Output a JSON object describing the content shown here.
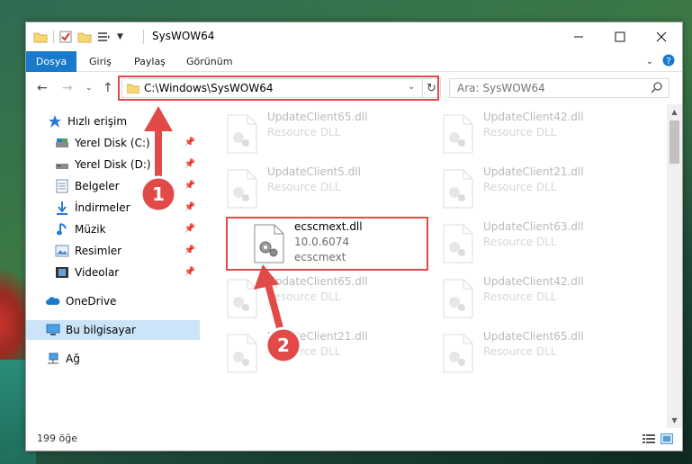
{
  "window": {
    "title": "SysWOW64"
  },
  "ribbon": {
    "tabs": [
      "Dosya",
      "Giriş",
      "Paylaş",
      "Görünüm"
    ],
    "active_tab": 0
  },
  "address": {
    "path": "C:\\Windows\\SysWOW64"
  },
  "search": {
    "placeholder": "Ara: SysWOW64"
  },
  "nav": {
    "items": [
      {
        "label": "Hızlı erişim",
        "icon": "star-icon",
        "pinned": false
      },
      {
        "label": "Yerel Disk (C:)",
        "icon": "drive-icon",
        "pinned": true
      },
      {
        "label": "Yerel Disk (D:)",
        "icon": "drive-icon",
        "pinned": true
      },
      {
        "label": "Belgeler",
        "icon": "documents-icon",
        "pinned": true
      },
      {
        "label": "İndirmeler",
        "icon": "download-icon",
        "pinned": true
      },
      {
        "label": "Müzik",
        "icon": "music-icon",
        "pinned": true
      },
      {
        "label": "Resimler",
        "icon": "pictures-icon",
        "pinned": true
      },
      {
        "label": "Videolar",
        "icon": "video-icon",
        "pinned": true
      },
      {
        "label": "OneDrive",
        "icon": "cloud-icon",
        "pinned": false
      },
      {
        "label": "Bu bilgisayar",
        "icon": "computer-icon",
        "pinned": false
      },
      {
        "label": "Ağ",
        "icon": "network-icon",
        "pinned": false
      }
    ]
  },
  "files": [
    {
      "name": "UpdateClient65.dll",
      "line2": "Resource DLL",
      "line3": ""
    },
    {
      "name": "UpdateClient42.dll",
      "line2": "Resource DLL",
      "line3": ""
    },
    {
      "name": "UpdateClient5.dll",
      "line2": "Resource DLL",
      "line3": ""
    },
    {
      "name": "UpdateClient21.dll",
      "line2": "Resource DLL",
      "line3": ""
    },
    {
      "name": "ecscmext.dll",
      "line2": "10.0.6074",
      "line3": "ecscmext"
    },
    {
      "name": "UpdateClient63.dll",
      "line2": "Resource DLL",
      "line3": ""
    },
    {
      "name": "UpdateClient65.dll",
      "line2": "Resource DLL",
      "line3": ""
    },
    {
      "name": "UpdateClient42.dll",
      "line2": "Resource DLL",
      "line3": ""
    },
    {
      "name": "UpdateClient21.dll",
      "line2": "Resource DLL",
      "line3": ""
    },
    {
      "name": "UpdateClient65.dll",
      "line2": "Resource DLL",
      "line3": ""
    }
  ],
  "status": {
    "item_count": "199 öğe"
  },
  "annotations": {
    "step1": "1",
    "step2": "2",
    "color": "#e24a4a"
  }
}
